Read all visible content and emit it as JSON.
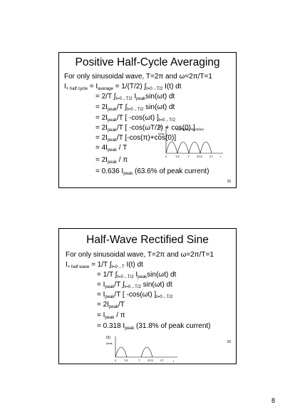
{
  "slide1": {
    "title": "Positive Half-Cycle Averaging",
    "lines": [
      {
        "pre": "For only sinusoidal wave, T=2π and ω=2π/T=1"
      },
      {
        "pre": "I",
        "sub": "+ half cycle",
        "post": " = I",
        "sub2": "average",
        "post2": " = 1/(T/2) ∫",
        "sub3": "t=0→T/2",
        "post3": " I(t) dt"
      },
      {
        "pre": "= 2/T ∫",
        "sub": "t=0→T/2",
        "post": " I",
        "sub2": "peak",
        "post2": "sin(ωt) dt"
      },
      {
        "pre": "= 2I",
        "sub": "peak",
        "post": "/T ∫",
        "sub2": "t=0→T/2",
        "post2": " sin(ωt) dt"
      },
      {
        "pre": "= 2I",
        "sub": "peak",
        "post": "/T [ -cos(ωt) ]",
        "sub2": "t=0→T/2",
        "post2": ""
      },
      {
        "pre": "= 2I",
        "sub": "peak",
        "post": "/T [ -cos(ωT/2) + cos(0) ]",
        "sub2": "",
        "post2": ""
      },
      {
        "pre": "= 2I",
        "sub": "peak",
        "post": "/T [-cos(π)+cos(0)]",
        "sub2": "",
        "post2": ""
      },
      {
        "pre": "= 4I",
        "sub": "peak",
        "post": " / T",
        "sub2": "",
        "post2": ""
      },
      {
        "pre": "= 2I",
        "sub": "peak",
        "post": " / π",
        "sub2": "",
        "post2": ""
      },
      {
        "pre": "= 0.636 I",
        "sub": "peak",
        "post": "  (63.6% of peak current)",
        "sub2": "",
        "post2": ""
      }
    ],
    "graph": {
      "ylabel": "I(t)",
      "peak_label": "Ipeak",
      "title": "Full Wave Rectified",
      "ticks": [
        "0",
        "T/2",
        "T",
        "3T/2",
        "2T"
      ],
      "xlabel": "t"
    },
    "number": "15"
  },
  "slide2": {
    "title": "Half-Wave Rectified Sine",
    "lines": [
      {
        "pre": "For only sinusoidal wave, T=2π and ω=2π/T=1"
      },
      {
        "pre": "I",
        "sub": "+ half wave",
        "post": " = 1/T ∫",
        "sub2": "t=0→T",
        "post2": " I(t) dt"
      },
      {
        "pre": "= 1/T ∫",
        "sub": "t=0→T/2",
        "post": " I",
        "sub2": "peak",
        "post2": "sin(ωt) dt"
      },
      {
        "pre": "= I",
        "sub": "peak",
        "post": "/T ∫",
        "sub2": "t=0→T/2",
        "post2": " sin(ωt) dt"
      },
      {
        "pre": "= I",
        "sub": "peak",
        "post": "/T [ -cos(ωt) ]",
        "sub2": "t=0→T/2",
        "post2": ""
      },
      {
        "pre": "= 2I",
        "sub": "peak",
        "post": "/T",
        "sub2": "",
        "post2": ""
      },
      {
        "pre": "= I",
        "sub": "peak",
        "post": " / π",
        "sub2": "",
        "post2": ""
      },
      {
        "pre": "= 0.318 I",
        "sub": "peak",
        "post": "  (31.8% of peak current)",
        "sub2": "",
        "post2": ""
      }
    ],
    "graph": {
      "ylabel": "I(t)",
      "peak_label": "Ipeak",
      "ticks": [
        "0",
        "T/2",
        "T",
        "3T/2",
        "2T"
      ],
      "xlabel": "t"
    },
    "number": "16"
  },
  "page_number": "8"
}
